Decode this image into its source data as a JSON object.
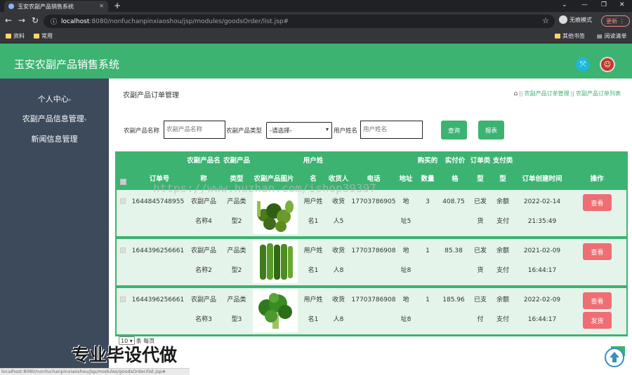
{
  "browser": {
    "tab_title": "玉安农副产品销售系统",
    "url_host": "localhost",
    "url_path": ":8080/nonfuchanpinxiaoshou/jsp/modules/goodsOrder/list.jsp#",
    "incognito_label": "无痕模式",
    "update_label": "更新",
    "bookmarks": [
      "资料",
      "常用"
    ],
    "bookmarks_right": [
      "其他书签",
      "阅读清单"
    ]
  },
  "app": {
    "title": "玉安农副产品销售系统"
  },
  "sidebar": {
    "items": [
      {
        "label": "个人中心"
      },
      {
        "label": "农副产品信息管理"
      },
      {
        "label": "新闻信息管理"
      }
    ]
  },
  "page": {
    "title": "农副产品订单管理",
    "breadcrumb": [
      "农副产品订单管理",
      "农副产品订单列表"
    ]
  },
  "filters": {
    "name_label": "农副产品名称",
    "name_placeholder": "农副产品名称",
    "type_label": "农副产品类型",
    "type_value": "-请选择-",
    "user_label": "用户姓名",
    "user_placeholder": "用户姓名",
    "search_label": "查询",
    "report_label": "报表"
  },
  "table": {
    "headers": {
      "order_no": "订单号",
      "name_top": "农副产品名",
      "name_bot": "称",
      "type_top": "农副产品",
      "type_bot": "类型",
      "image": "农副产品图片",
      "user_top": "用户姓",
      "user_bot": "名",
      "receiver": "收货人",
      "phone": "电话",
      "address": "地址",
      "qty_top": "购买的",
      "qty_bot": "数量",
      "price_top": "实付价",
      "price_bot": "格",
      "otype_top": "订单类",
      "otype_bot": "型",
      "pay_top": "支付类",
      "pay_bot": "型",
      "created": "订单创建时间",
      "ops": "操作"
    },
    "rows": [
      {
        "order_no": "1644845748955",
        "name1": "农副产品",
        "name2": "名称4",
        "type1": "产品类",
        "type2": "型2",
        "user1": "用户姓",
        "user2": "名1",
        "recv1": "收货",
        "recv2": "人5",
        "phone": "17703786905",
        "addr1": "地",
        "addr2": "址5",
        "qty": "3",
        "price": "408.75",
        "otype1": "已发",
        "otype2": "货",
        "pay1": "余额",
        "pay2": "支付",
        "date": "2022-02-14",
        "time": "21:35:49",
        "view": "查看"
      },
      {
        "order_no": "1644396256661",
        "name1": "农副产品",
        "name2": "名称2",
        "type1": "产品类",
        "type2": "型2",
        "user1": "用户姓",
        "user2": "名1",
        "recv1": "收货",
        "recv2": "人8",
        "phone": "17703786908",
        "addr1": "地",
        "addr2": "址8",
        "qty": "1",
        "price": "85.38",
        "otype1": "已发",
        "otype2": "货",
        "pay1": "余额",
        "pay2": "支付",
        "date": "2021-02-09",
        "time": "16:44:17",
        "view": "查看"
      },
      {
        "order_no": "1644396256661",
        "name1": "农副产品",
        "name2": "名称3",
        "type1": "产品类",
        "type2": "型3",
        "user1": "用户姓",
        "user2": "名1",
        "recv1": "收货",
        "recv2": "人8",
        "phone": "17703786908",
        "addr1": "地",
        "addr2": "址8",
        "qty": "1",
        "price": "185.96",
        "otype1": "已支",
        "otype2": "付",
        "pay1": "余额",
        "pay2": "支付",
        "date": "2022-02-09",
        "time": "16:44:17",
        "view": "查看",
        "ship": "发货"
      }
    ]
  },
  "pager": {
    "page_size": "10",
    "suffix": "条 每页"
  },
  "overlay": {
    "watermark": "https://www.huzhan.com/ishop39397",
    "promo": "专业毕设代做",
    "status_url": "localhost:8080/nonfuchanpinxiaoshou/jsp/modules/goodsOrder/list.jsp#"
  },
  "colors": {
    "primary": "#3cb371",
    "sidebar": "#3d4a5c",
    "danger": "#ee6e73",
    "row_bg": "#e4f4ea"
  }
}
